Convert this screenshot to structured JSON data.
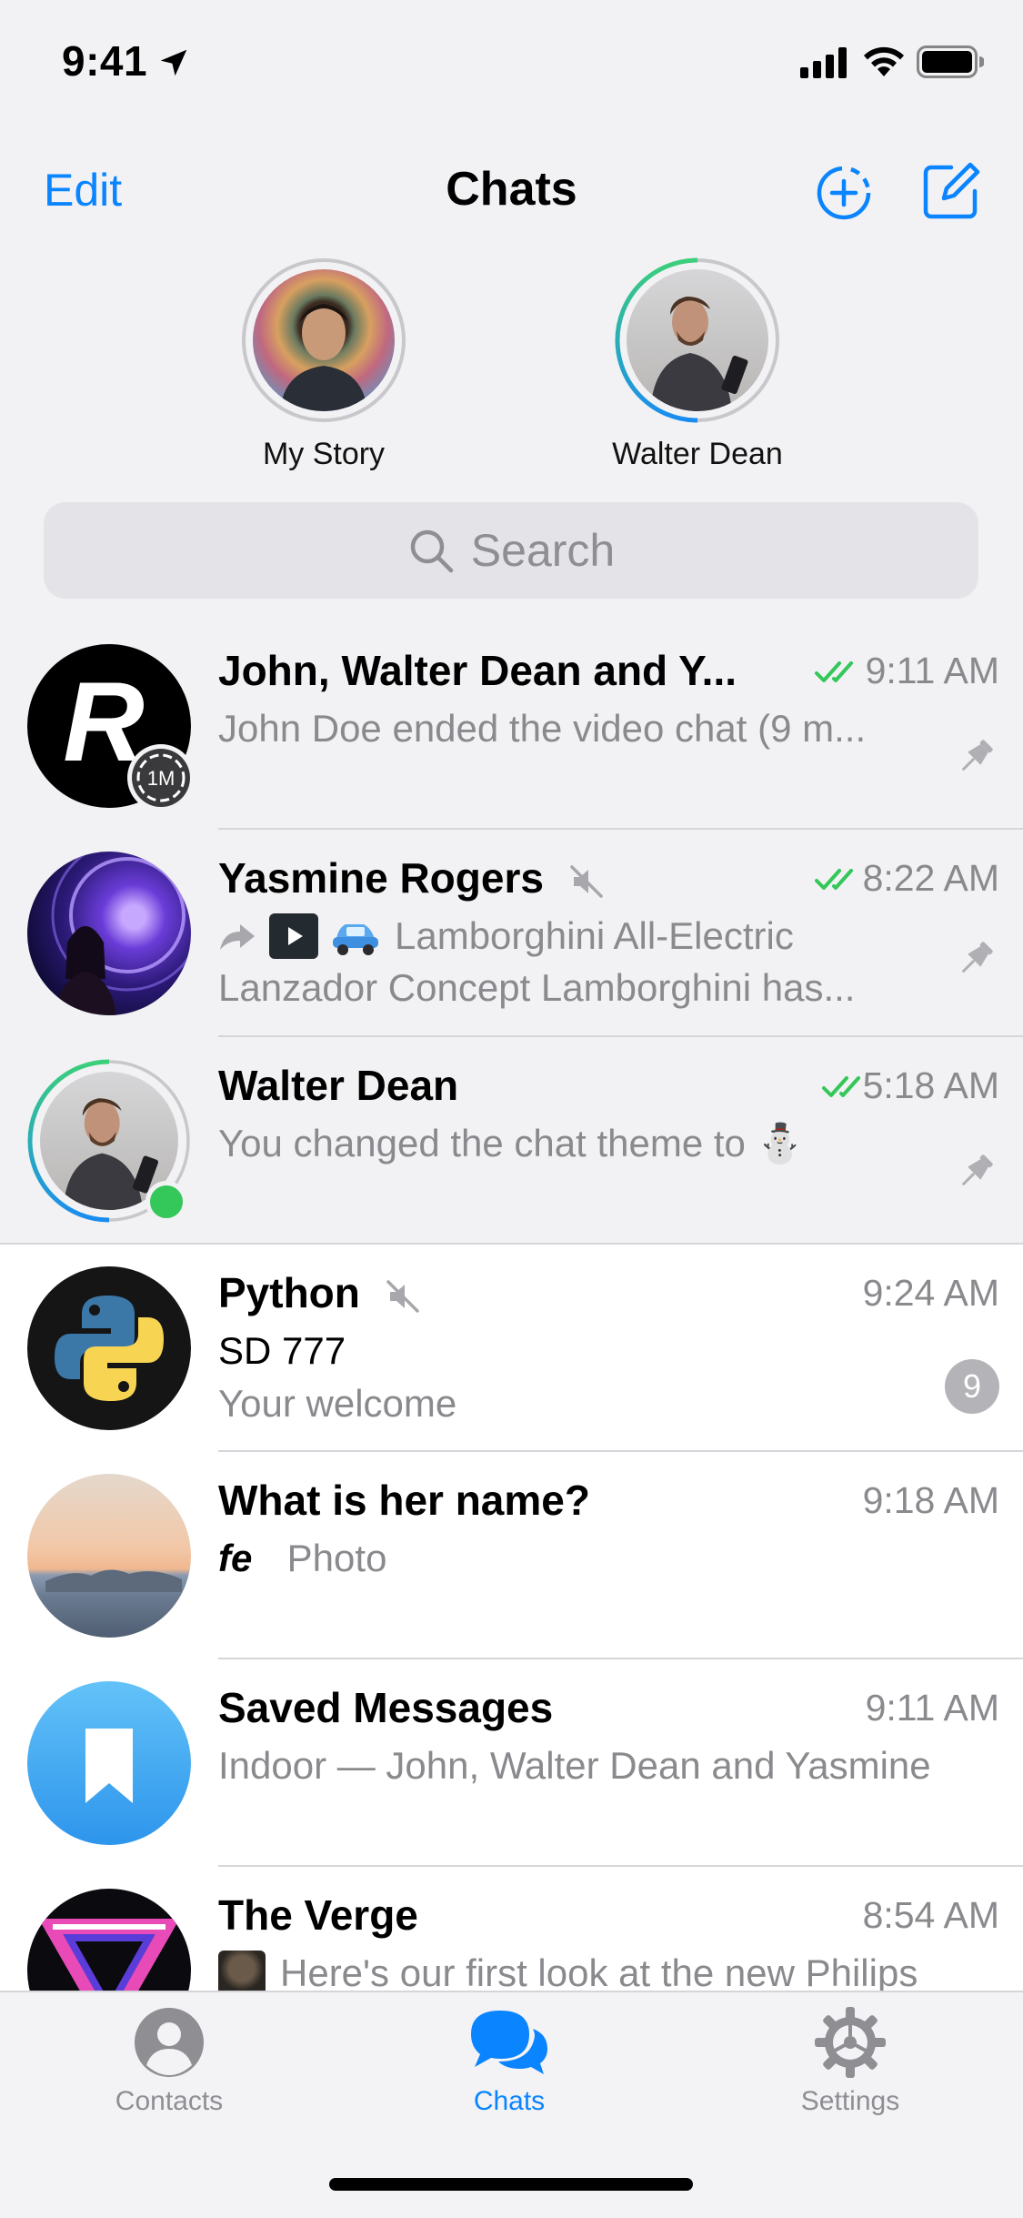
{
  "status_bar": {
    "time": "9:41"
  },
  "nav": {
    "edit": "Edit",
    "title": "Chats"
  },
  "stories": [
    {
      "label": "My Story"
    },
    {
      "label": "Walter Dean"
    }
  ],
  "search": {
    "placeholder": "Search"
  },
  "chats": [
    {
      "name": "John, Walter Dean and Y...",
      "time": "9:11 AM",
      "preview": "John Doe ended the video chat (9 m...",
      "read": true,
      "pinned": true,
      "avatar_badge": "1M"
    },
    {
      "name": "Yasmine Rogers",
      "time": "8:22 AM",
      "preview_line1": "Lamborghini All-Electric",
      "preview_line2": "Lanzador Concept Lamborghini has...",
      "read": true,
      "pinned": true,
      "muted": true
    },
    {
      "name": "Walter Dean",
      "time": "5:18 AM",
      "preview": "You changed the chat theme to ⛄",
      "read": true,
      "pinned": true,
      "online": true
    },
    {
      "name": "Python",
      "time": "9:24 AM",
      "sender": "SD 777",
      "preview": "Your welcome",
      "unread": "9",
      "muted": true
    },
    {
      "name": "What is her name?",
      "time": "9:18 AM",
      "preview_glyph": "fe",
      "preview": "Photo"
    },
    {
      "name": "Saved Messages",
      "time": "9:11 AM",
      "preview": "Indoor — John, Walter Dean and Yasmine"
    },
    {
      "name": "The Verge",
      "time": "8:54 AM",
      "preview": "Here's our first look at the new Philips"
    }
  ],
  "tabs": [
    {
      "label": "Contacts",
      "icon": "person-circle-icon"
    },
    {
      "label": "Chats",
      "icon": "chat-bubbles-icon",
      "active": true
    },
    {
      "label": "Settings",
      "icon": "gear-icon"
    }
  ],
  "colors": {
    "accent": "#0a84ff",
    "read_check": "#34c759",
    "online": "#34c759",
    "background": "#f2f2f4"
  }
}
